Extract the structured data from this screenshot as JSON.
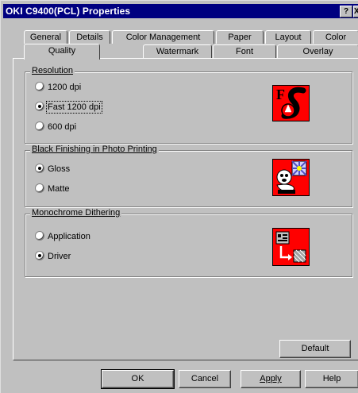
{
  "window": {
    "title": "OKI C9400(PCL) Properties",
    "help_btn": "?",
    "close_btn": "X"
  },
  "tabs": {
    "row1": [
      "General",
      "Details",
      "Color Management",
      "Paper",
      "Layout",
      "Color"
    ],
    "row2": [
      "Quality",
      "Watermark",
      "Font",
      "Overlay"
    ],
    "active": "Quality"
  },
  "resolution": {
    "label": "Resolution",
    "options": [
      "1200 dpi",
      "Fast 1200 dpi",
      "600 dpi"
    ],
    "selected": "Fast 1200 dpi"
  },
  "black_finishing": {
    "label": "Black Finishing in Photo Printing",
    "options": [
      "Gloss",
      "Matte"
    ],
    "selected": "Gloss"
  },
  "monochrome": {
    "label": "Monochrome Dithering",
    "options": [
      "Application",
      "Driver"
    ],
    "selected": "Driver"
  },
  "buttons": {
    "default": "Default",
    "ok": "OK",
    "cancel": "Cancel",
    "apply": "Apply",
    "help": "Help"
  },
  "colors": {
    "title_bar": "#000080",
    "dialog_bg": "#c0c0c0",
    "preview_red": "#ff0000"
  }
}
